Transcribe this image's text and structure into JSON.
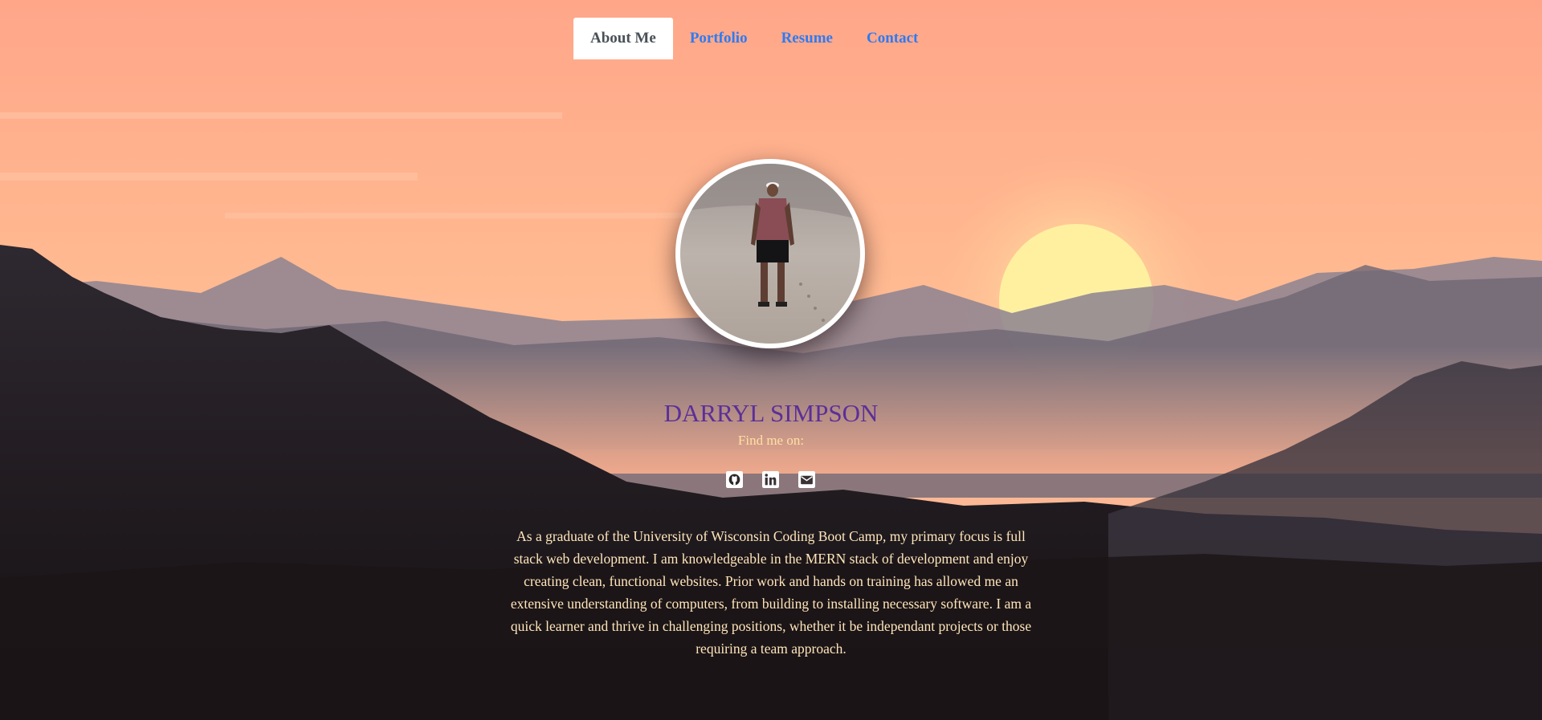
{
  "nav": {
    "items": [
      {
        "label": "About Me",
        "active": true
      },
      {
        "label": "Portfolio",
        "active": false
      },
      {
        "label": "Resume",
        "active": false
      },
      {
        "label": "Contact",
        "active": false
      }
    ]
  },
  "profile": {
    "name": "DARRYL SIMPSON",
    "find_me": "Find me on:",
    "socials": [
      {
        "icon": "github-icon"
      },
      {
        "icon": "linkedin-icon"
      },
      {
        "icon": "envelope-icon"
      }
    ],
    "bio": "As a graduate of the University of Wisconsin Coding Boot Camp, my primary focus is full stack web development. I am knowledgeable in the MERN stack of development and enjoy creating clean, functional websites. Prior work and hands on training has allowed me an extensive understanding of computers, from building to installing necessary software. I am a quick learner and thrive in challenging positions, whether it be independant projects or those requiring a team approach."
  },
  "colors": {
    "nav_link": "#2f7af2",
    "nav_active_text": "#495057",
    "name": "#5b2f99",
    "body_text": "#ffe6ba"
  }
}
